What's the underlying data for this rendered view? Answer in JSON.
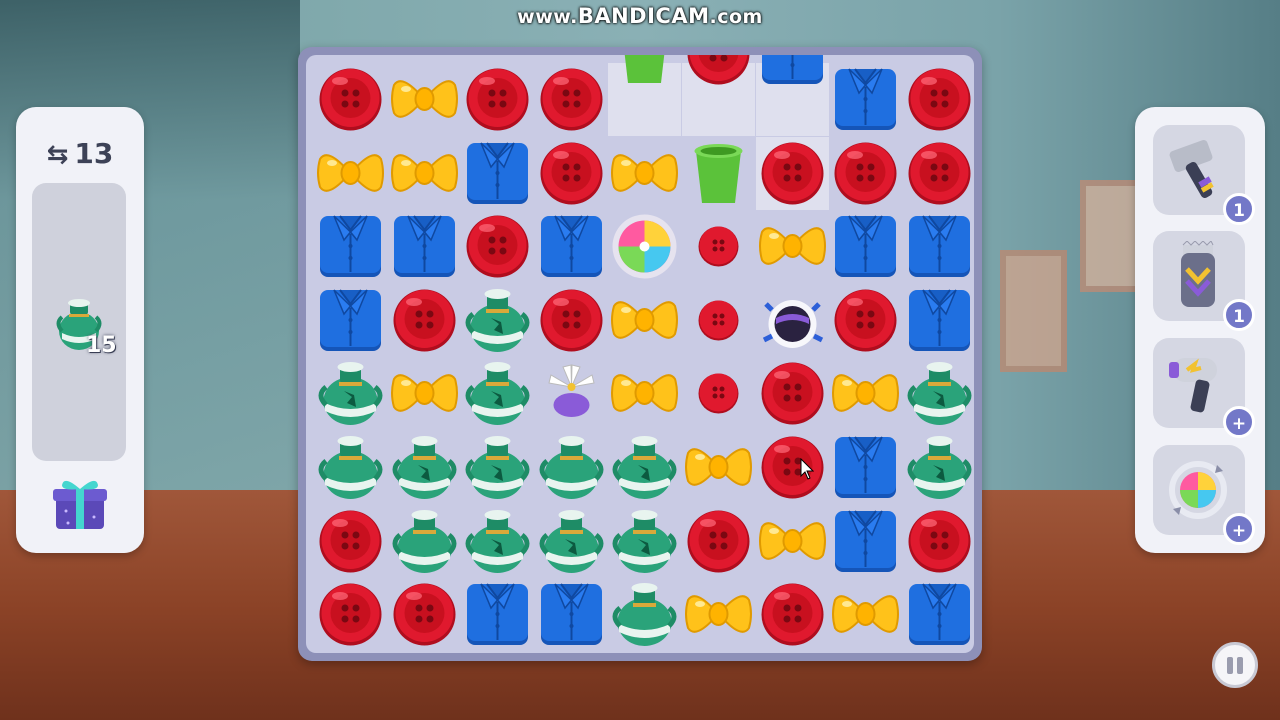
{
  "watermark": {
    "prefix": "www.",
    "brand": "BANDICAM",
    "suffix": ".com"
  },
  "hud": {
    "moves_left": "13",
    "goal": {
      "item": "vase-icon",
      "remaining": "15"
    }
  },
  "boosters": [
    {
      "name": "hammer",
      "icon": "hammer-icon",
      "count": "1"
    },
    {
      "name": "trimmer",
      "icon": "trimmer-icon",
      "count": "1"
    },
    {
      "name": "hair-dryer",
      "icon": "hair-dryer-icon",
      "count": "+"
    },
    {
      "name": "shuffle",
      "icon": "shuffle-icon",
      "count": "+"
    }
  ],
  "board": {
    "rows": 8,
    "cols": 9,
    "grid": [
      [
        "button",
        "bow",
        "button",
        "button",
        "empty:cup",
        "empty:button",
        "empty:shirt",
        "shirt",
        "button"
      ],
      [
        "bow",
        "bow",
        "shirt",
        "button",
        "bow",
        "cup",
        "empty:button",
        "button",
        "button"
      ],
      [
        "shirt",
        "shirt",
        "button",
        "shirt",
        "rainbow",
        "small-button",
        "bow",
        "shirt",
        "shirt"
      ],
      [
        "shirt",
        "button",
        "vase-cracked",
        "button",
        "bow",
        "small-button",
        "bomb",
        "button",
        "shirt"
      ],
      [
        "vase-cracked",
        "bow",
        "vase-cracked",
        "propeller",
        "bow",
        "small-button",
        "button",
        "bow",
        "vase-cracked"
      ],
      [
        "vase",
        "vase-cracked",
        "vase-cracked",
        "vase",
        "vase-cracked",
        "bow",
        "button",
        "shirt",
        "vase-cracked"
      ],
      [
        "button",
        "vase",
        "vase-cracked",
        "vase-cracked",
        "vase-cracked",
        "button",
        "bow",
        "shirt",
        "button"
      ],
      [
        "button",
        "button",
        "shirt",
        "shirt",
        "vase",
        "bow",
        "button",
        "bow",
        "shirt"
      ]
    ]
  },
  "colors": {
    "button": "#e0192e",
    "bow": "#ffc21a",
    "shirt": "#1f6fe0",
    "vase": "#2aa37a",
    "cup": "#5bc23a",
    "panel": "#f1f2f8",
    "board_frame": "#8d90b8"
  }
}
